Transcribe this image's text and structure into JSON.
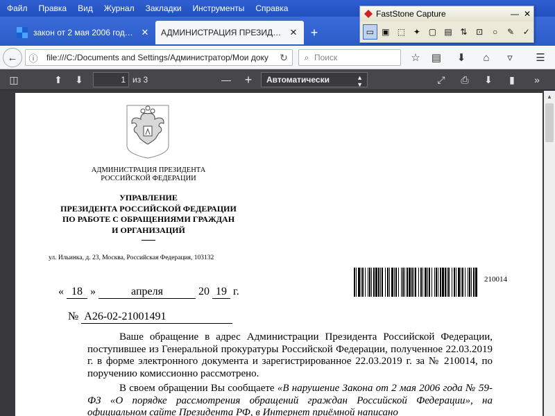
{
  "menu": [
    "Файл",
    "Правка",
    "Вид",
    "Журнал",
    "Закладки",
    "Инструменты",
    "Справка"
  ],
  "tabs": [
    {
      "title": "закон от 2 мая 2006 года N...",
      "active": false
    },
    {
      "title": "АДМИНИСТРАЦИЯ ПРЕЗИДЕНТА ...",
      "active": true
    }
  ],
  "navbar": {
    "url": "file:///C:/Documents and Settings/Администратор/Мои доку",
    "search_placeholder": "Поиск"
  },
  "faststone": {
    "title": "FastStone Capture"
  },
  "pdf_toolbar": {
    "page_number": "1",
    "page_count": "из 3",
    "zoom": "Автоматически"
  },
  "document": {
    "admin_line1": "АДМИНИСТРАЦИЯ ПРЕЗИДЕНТА",
    "admin_line2": "РОССИЙСКОЙ ФЕДЕРАЦИИ",
    "dept_line1": "УПРАВЛЕНИЕ",
    "dept_line2": "ПРЕЗИДЕНТА РОССИЙСКОЙ ФЕДЕРАЦИИ",
    "dept_line3": "ПО РАБОТЕ С ОБРАЩЕНИЯМИ ГРАЖДАН",
    "dept_line4": "И ОРГАНИЗАЦИЙ",
    "address": "ул. Ильинка, д. 23, Москва, Российская Федерация, 103132",
    "barcode_number": "210014",
    "date": {
      "open_quote": "«",
      "day": "18",
      "close_quote": "»",
      "month": "апреля",
      "year_prefix": "20",
      "year_suffix": "19",
      "year_unit": "г."
    },
    "number_prefix": "№",
    "number": "А26-02-21001491",
    "paragraph1": "Ваше обращение в адрес Администрации Президента Российской Федерации, поступившее из Генеральной прокуратуры Российской Федерации, полученное 22.03.2019 г. в форме электронного документа и зарегистрированное 22.03.2019 г. за № 210014, по поручению комиссионно рассмотрено.",
    "paragraph2_plain": "В своем обращении Вы сообщаете ",
    "paragraph2_italic": "«В нарушение Закона от 2 мая 2006 года № 59-ФЗ «О порядке рассмотрения обращений граждан Российской Федерации», на официальном сайте Президента РФ, в Интернет приёмной написано"
  },
  "colors": {
    "titlebar_blue": "#2b5cc8",
    "pdf_toolbar": "#474749",
    "viewer_bg": "#38383d"
  }
}
